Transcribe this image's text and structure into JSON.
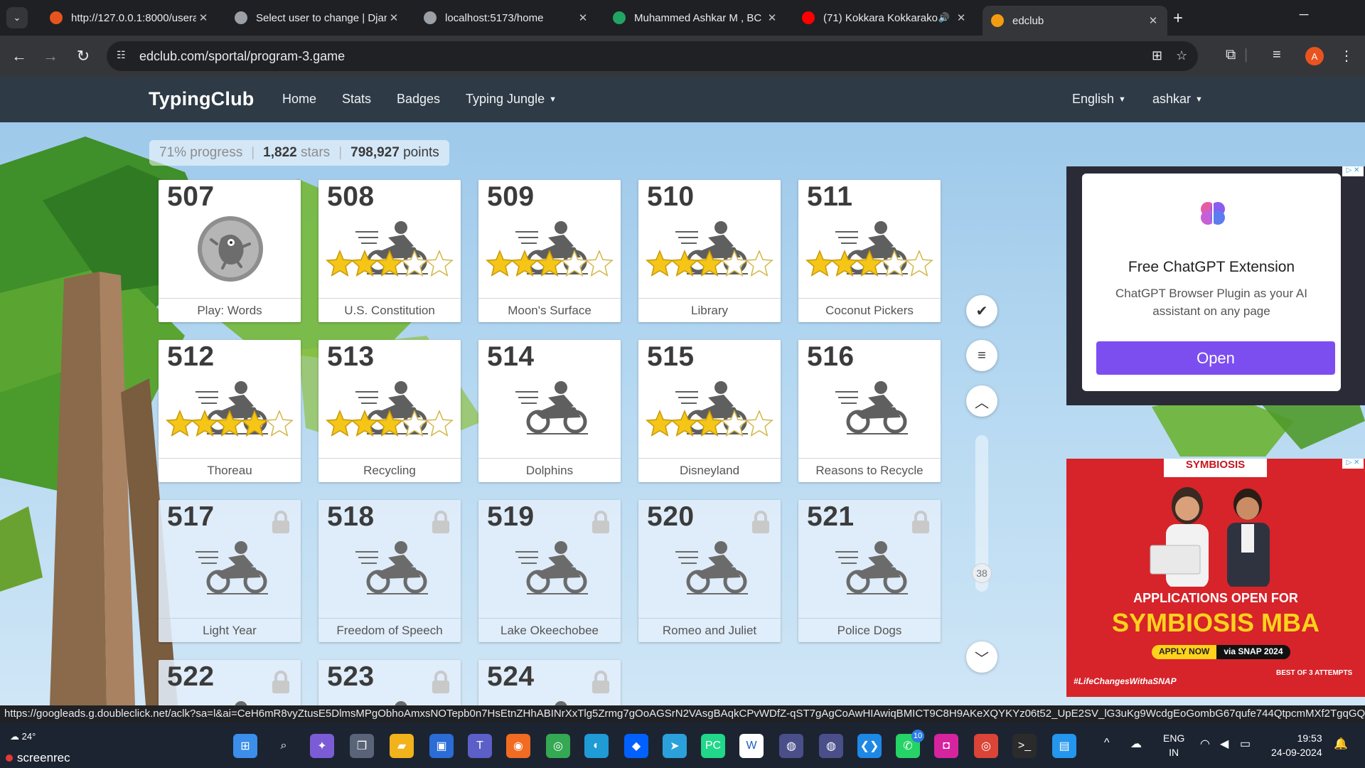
{
  "browser": {
    "tabs": [
      {
        "title": "http://127.0.0.1:8000/usera",
        "favicon": "orange-icon",
        "active": false
      },
      {
        "title": "Select user to change | Djan",
        "favicon": "globe-icon",
        "active": false
      },
      {
        "title": "localhost:5173/home",
        "favicon": "globe-icon",
        "active": false
      },
      {
        "title": "Muhammed Ashkar M , BC",
        "favicon": "sheets-icon",
        "active": false
      },
      {
        "title": "(71) Kokkara Kokkarako",
        "favicon": "youtube-icon",
        "active": false
      },
      {
        "title": "edclub",
        "favicon": "edclub-icon",
        "active": true
      }
    ],
    "url": "edclub.com/sportal/program-3.game",
    "profile_initial": "A"
  },
  "site": {
    "brand": "TypingClub",
    "nav": [
      "Home",
      "Stats",
      "Badges",
      "Typing Jungle"
    ],
    "language": "English",
    "user": "ashkar"
  },
  "progress": {
    "percent": "71% progress",
    "stars_num": "1,822",
    "stars_word": "stars",
    "points_num": "798,927",
    "points_word": "points"
  },
  "lessons": [
    {
      "num": "507",
      "name": "Play: Words",
      "kind": "game",
      "stars": 0,
      "locked": false
    },
    {
      "num": "508",
      "name": "U.S. Constitution",
      "kind": "bike",
      "stars": 3,
      "locked": false
    },
    {
      "num": "509",
      "name": "Moon's Surface",
      "kind": "bike",
      "stars": 3,
      "locked": false
    },
    {
      "num": "510",
      "name": "Library",
      "kind": "bike",
      "stars": 3,
      "locked": false
    },
    {
      "num": "511",
      "name": "Coconut Pickers",
      "kind": "bike",
      "stars": 3,
      "locked": false
    },
    {
      "num": "512",
      "name": "Thoreau",
      "kind": "bike",
      "stars": 4,
      "locked": false
    },
    {
      "num": "513",
      "name": "Recycling",
      "kind": "bike",
      "stars": 3,
      "locked": false
    },
    {
      "num": "514",
      "name": "Dolphins",
      "kind": "bike",
      "stars": 0,
      "locked": false
    },
    {
      "num": "515",
      "name": "Disneyland",
      "kind": "bike",
      "stars": 3,
      "locked": false
    },
    {
      "num": "516",
      "name": "Reasons to Recycle",
      "kind": "bike",
      "stars": 0,
      "locked": false
    },
    {
      "num": "517",
      "name": "Light Year",
      "kind": "bike",
      "stars": 0,
      "locked": true
    },
    {
      "num": "518",
      "name": "Freedom of Speech",
      "kind": "bike",
      "stars": 0,
      "locked": true
    },
    {
      "num": "519",
      "name": "Lake Okeechobee",
      "kind": "bike",
      "stars": 0,
      "locked": true
    },
    {
      "num": "520",
      "name": "Romeo and Juliet",
      "kind": "bike",
      "stars": 0,
      "locked": true
    },
    {
      "num": "521",
      "name": "Police Dogs",
      "kind": "bike",
      "stars": 0,
      "locked": true
    },
    {
      "num": "522",
      "name": "",
      "kind": "bike",
      "stars": 0,
      "locked": true
    },
    {
      "num": "523",
      "name": "",
      "kind": "bike",
      "stars": 0,
      "locked": true
    },
    {
      "num": "524",
      "name": "",
      "kind": "bike",
      "stars": 0,
      "locked": true
    }
  ],
  "side_controls": {
    "scroll_value": "38"
  },
  "ads": {
    "chatgpt": {
      "title": "Free ChatGPT Extension",
      "body": "ChatGPT Browser Plugin as your AI assistant on any page",
      "button": "Open"
    },
    "symbiosis": {
      "logo": "SYMBIOSIS",
      "headline": "APPLICATIONS OPEN FOR",
      "program": "SYMBIOSIS MBA",
      "apply": "APPLY NOW",
      "via": "via SNAP 2024",
      "hashtag": "#LifeChangesWithaSNAP",
      "attempts": "BEST OF 3 ATTEMPTS"
    }
  },
  "status_link": "https://googleads.g.doubleclick.net/aclk?sa=l&ai=CeH6mR8vyZtusE5DlmsMPgObhoAmxsNOTepb0n7HsEtnZHhABINrXxTlg5Zrmg7gOoAGSrN2VAsgBAqkCPvWDfZ-qST7gAgCoAwHIAwiqBMICT9C8H9AKeXQYKYz06t52_UpE2SV_lG3uKg9WcdgEoGombG67qufe744QtpcmMXf2TgqGQ...",
  "taskbar": {
    "weather": "24°",
    "recorder": "screenrec",
    "lang_top": "ENG",
    "lang_bottom": "IN",
    "time": "19:53",
    "date": "24-09-2024",
    "whatsapp_badge": "10"
  },
  "colors": {
    "nav_bg": "#2e3a45",
    "ad_button": "#7c4ef0",
    "star": "#f5c518",
    "ad2_bg": "#d6242a"
  }
}
